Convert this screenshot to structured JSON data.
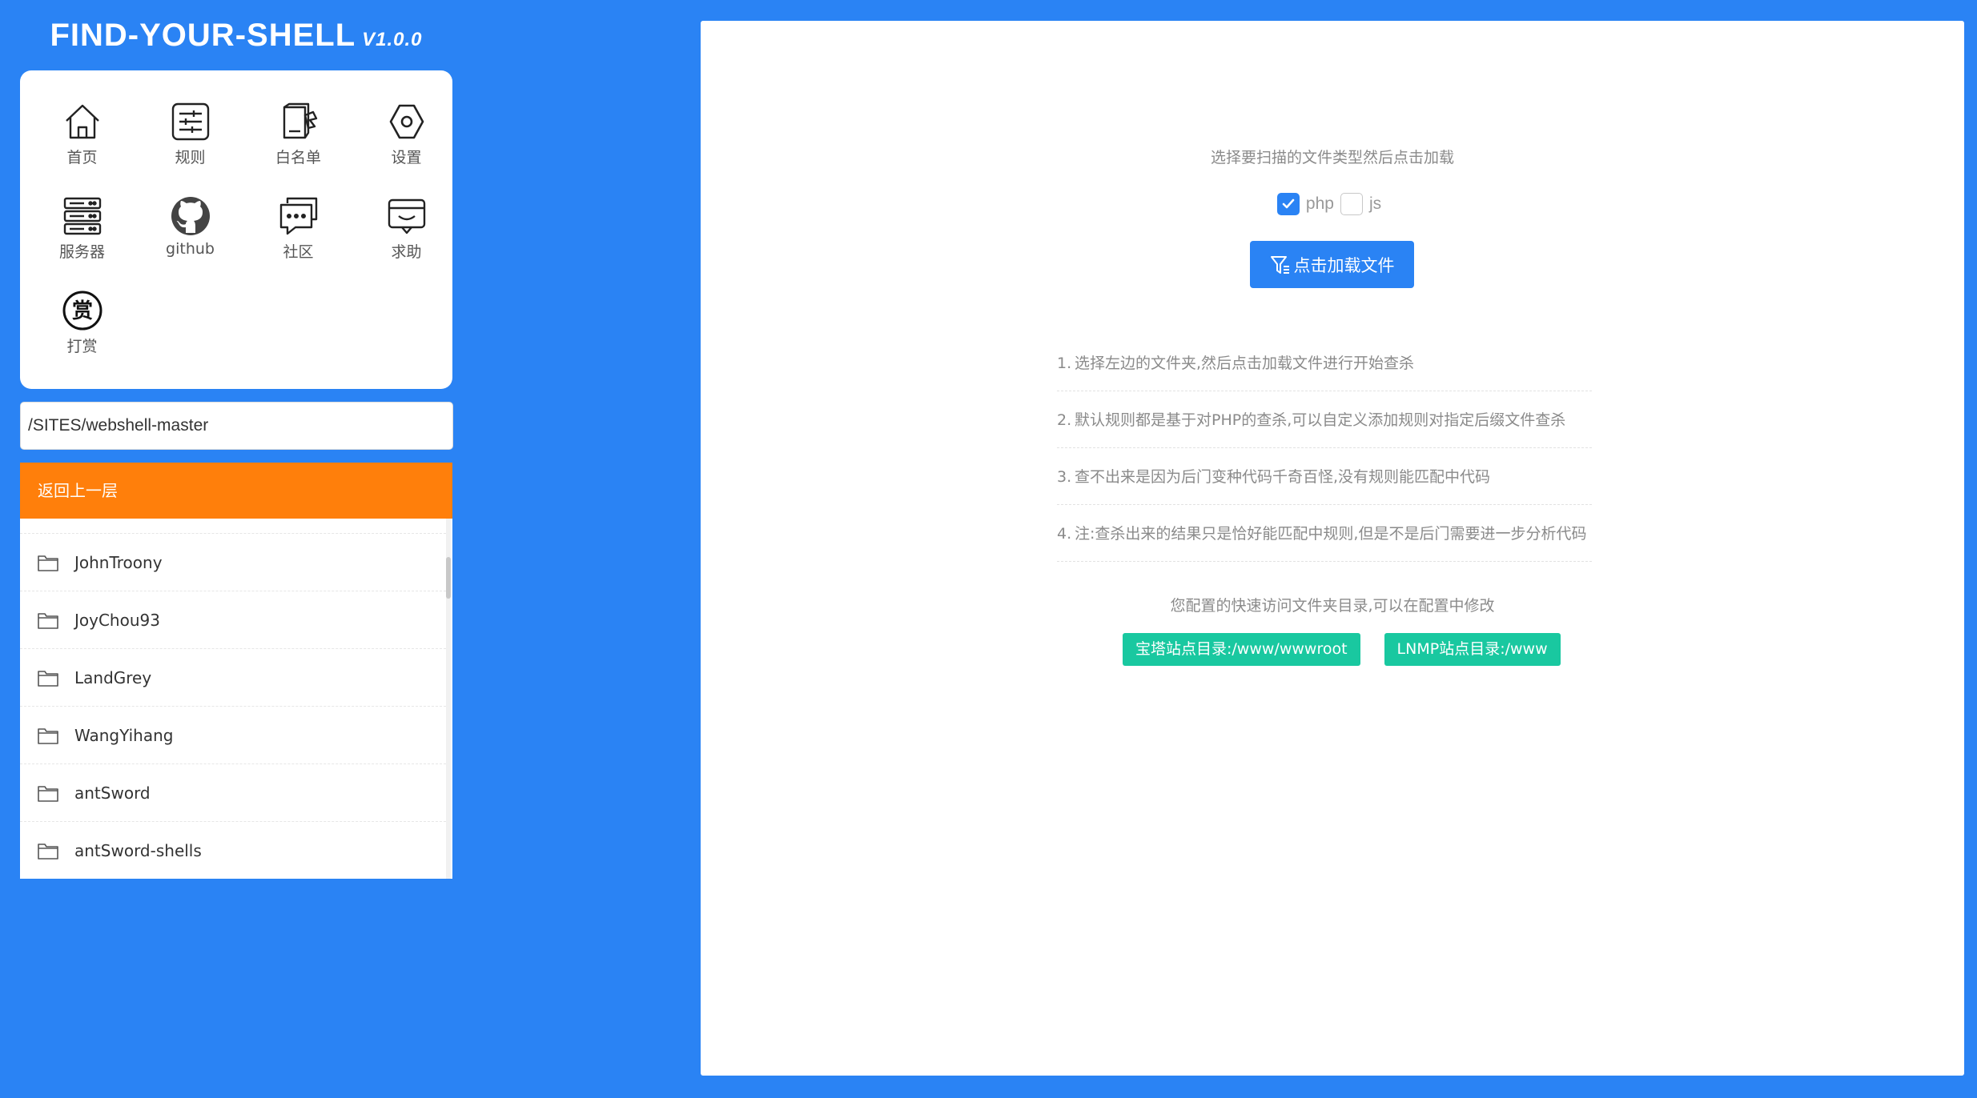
{
  "app": {
    "title": "FIND-YOUR-SHELL",
    "version": "V1.0.0"
  },
  "nav": {
    "items": [
      {
        "label": "首页",
        "icon": "home-icon"
      },
      {
        "label": "规则",
        "icon": "rules-icon"
      },
      {
        "label": "白名单",
        "icon": "whitelist-icon"
      },
      {
        "label": "设置",
        "icon": "settings-icon"
      },
      {
        "label": "服务器",
        "icon": "server-icon"
      },
      {
        "label": "github",
        "icon": "github-icon"
      },
      {
        "label": "社区",
        "icon": "community-icon"
      },
      {
        "label": "求助",
        "icon": "help-icon"
      },
      {
        "label": "打赏",
        "icon": "reward-icon"
      }
    ]
  },
  "path": {
    "value": "/SITES/webshell-master"
  },
  "browser": {
    "back_label": "返回上一层",
    "folders": [
      {
        "name": "JohnTroony"
      },
      {
        "name": "JoyChou93"
      },
      {
        "name": "LandGrey"
      },
      {
        "name": "WangYihang"
      },
      {
        "name": "antSword"
      },
      {
        "name": "antSword-shells"
      }
    ]
  },
  "main": {
    "prompt": "选择要扫描的文件类型然后点击加载",
    "file_types": [
      {
        "label": "php",
        "checked": true
      },
      {
        "label": "js",
        "checked": false
      }
    ],
    "load_button_label": "点击加载文件",
    "tips": [
      {
        "num": "1.",
        "text": "选择左边的文件夹,然后点击加载文件进行开始查杀"
      },
      {
        "num": "2.",
        "text": "默认规则都是基于对PHP的查杀,可以自定义添加规则对指定后缀文件查杀"
      },
      {
        "num": "3.",
        "text": "查不出来是因为后门变种代码千奇百怪,没有规则能匹配中代码"
      },
      {
        "num": "4.",
        "text": "注:查杀出来的结果只是恰好能匹配中规则,但是不是后门需要进一步分析代码"
      }
    ],
    "shortcut_prompt": "您配置的快速访问文件夹目录,可以在配置中修改",
    "shortcuts": [
      {
        "label": "宝塔站点目录:/www/wwwroot"
      },
      {
        "label": "LNMP站点目录:/www"
      }
    ]
  },
  "colors": {
    "background": "#2a83f4",
    "back_button": "#ff7f0b",
    "primary_button": "#2a83f4",
    "shortcut_button": "#19c8a0"
  }
}
